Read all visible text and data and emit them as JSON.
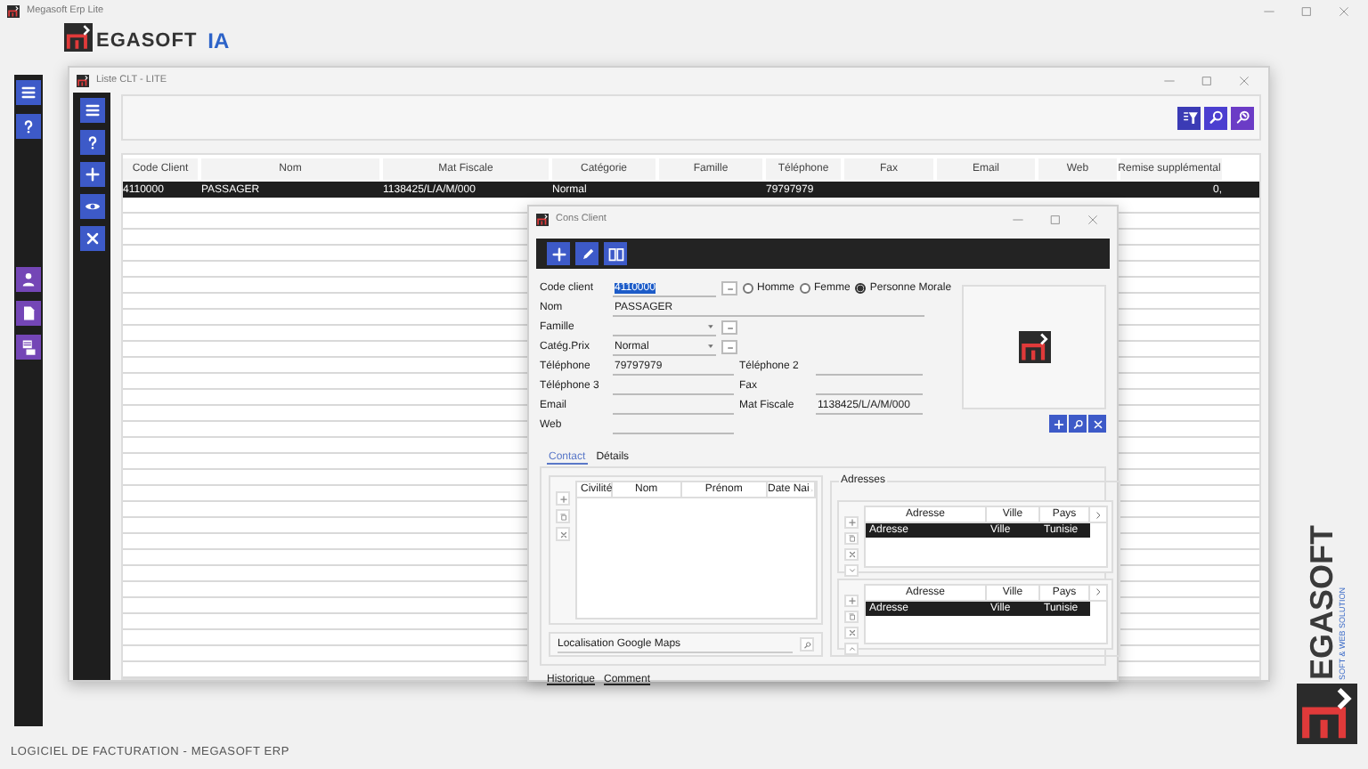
{
  "app": {
    "title": "Megasoft Erp Lite"
  },
  "logo": {
    "brand": "EGASOFT",
    "suffix": "IA"
  },
  "list_window": {
    "title": "Liste CLT - LITE",
    "table": {
      "columns": [
        "Code Client",
        "Nom",
        "Mat Fiscale",
        "Catégorie",
        "Famille",
        "Téléphone",
        "Fax",
        "Email",
        "Web",
        "Remise supplémental"
      ],
      "rows": [
        {
          "selected": true,
          "cells": [
            "4110000",
            "PASSAGER",
            "1138425/L/A/M/000",
            "Normal",
            null,
            "79797979",
            null,
            null,
            null,
            "0,"
          ]
        }
      ]
    }
  },
  "dialog": {
    "title": "Cons Client",
    "code_client": {
      "label": "Code client",
      "value": "4110000",
      "text_selected": true
    },
    "gender_options": [
      {
        "label": "Homme",
        "selected": false
      },
      {
        "label": "Femme",
        "selected": false
      },
      {
        "label": "Personne Morale",
        "selected": true
      }
    ],
    "nom": {
      "label": "Nom",
      "value": "PASSAGER"
    },
    "famille": {
      "label": "Famille"
    },
    "categ_prix": {
      "label": "Catég.Prix",
      "value": "Normal"
    },
    "fields": [
      {
        "label": "Téléphone",
        "value": "79797979"
      },
      {
        "label": "Téléphone 2"
      },
      {
        "label": "Téléphone 3"
      },
      {
        "label": "Fax"
      },
      {
        "label": "Email"
      },
      {
        "label": "Mat Fiscale",
        "value": "1138425/L/A/M/000"
      },
      {
        "label": "Web"
      }
    ],
    "tabs": [
      {
        "label": "Contact",
        "selected": true
      },
      {
        "label": "Détails",
        "selected": false
      }
    ],
    "contacts": {
      "columns": [
        "Civilité",
        "Nom",
        "Prénom",
        "Date Nai"
      ]
    },
    "maps": {
      "label": "Localisation Google Maps"
    },
    "addresses": {
      "title": "Adresses",
      "tables": [
        {
          "columns": [
            "Adresse",
            "Ville",
            "Pays"
          ],
          "rows": [
            {
              "selected": true,
              "cells": [
                "Adresse",
                "Ville",
                "Tunisie"
              ]
            }
          ]
        },
        {
          "columns": [
            "Adresse",
            "Ville",
            "Pays"
          ],
          "rows": [
            {
              "selected": true,
              "cells": [
                "Adresse",
                "Ville",
                "Tunisie"
              ]
            }
          ]
        }
      ]
    },
    "links": [
      "Historique",
      "Comment"
    ]
  },
  "side_logo": {
    "brand": "EGASOFT",
    "tagline": "SOFT & WEB SOLUTION"
  },
  "status_bar": {
    "text": "LOGICIEL DE FACTURATION - MEGASOFT ERP"
  }
}
